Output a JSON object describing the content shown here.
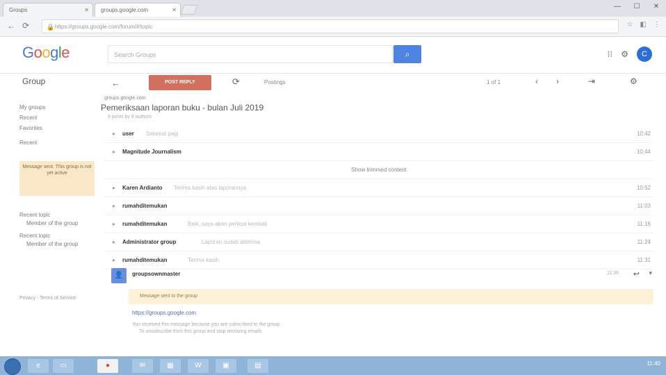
{
  "browser": {
    "tabs": [
      {
        "label": "Groups"
      },
      {
        "label": "groups.google.com"
      }
    ],
    "url": "https://groups.google.com/forum/#!topic"
  },
  "header": {
    "search_placeholder": "Search Groups",
    "avatar_letter": "C"
  },
  "sidebar": {
    "groups_label": "Group",
    "top_items": [
      "My groups",
      "Recent",
      "Favorites"
    ],
    "section_label": "Recent",
    "notice": "Message sent. This group is not yet active",
    "items": [
      "Recent topic",
      "Member of the group",
      "Recent topic",
      "Member of the group"
    ],
    "footer": "Privacy - Terms of Service"
  },
  "actions": {
    "post_reply": "POST REPLY",
    "sort": "Postings",
    "pager": "1 of 1"
  },
  "topic": {
    "crumb": "groups.google.com",
    "title": "Pemeriksaan laporan buku - bulan Juli 2019",
    "subtitle": "9 posts by 6 authors"
  },
  "messages": [
    {
      "author": "user",
      "snippet": "Selamat pagi",
      "time": "10:42"
    },
    {
      "author": "Magnitude Journalism",
      "snippet": "",
      "time": "10:44"
    },
    {
      "author": "Karen Ardianto",
      "snippet": "Terima kasih atas laporannya",
      "time": "10:52"
    },
    {
      "author": "rumahditemukan",
      "snippet": "",
      "time": "11:03"
    },
    {
      "author": "rumahditemukan",
      "snippet": "Baik, saya akan periksa kembali",
      "time": "11:16"
    },
    {
      "author": "Administrator group",
      "snippet": "Laporan sudah diterima",
      "time": "11:24"
    },
    {
      "author": "rumahditemukan",
      "snippet": "Terima kasih",
      "time": "11:31"
    }
  ],
  "expand_label": "Show trimmed content",
  "last_message": {
    "author": "groupsownmaster",
    "time": "11:36",
    "banner": "Message sent to the group",
    "link": "https://groups.google.com",
    "footer1": "You received this message because you are subscribed to the group",
    "footer2": "To unsubscribe from this group and stop receiving emails"
  },
  "taskbar": {
    "clock": "11:40"
  }
}
